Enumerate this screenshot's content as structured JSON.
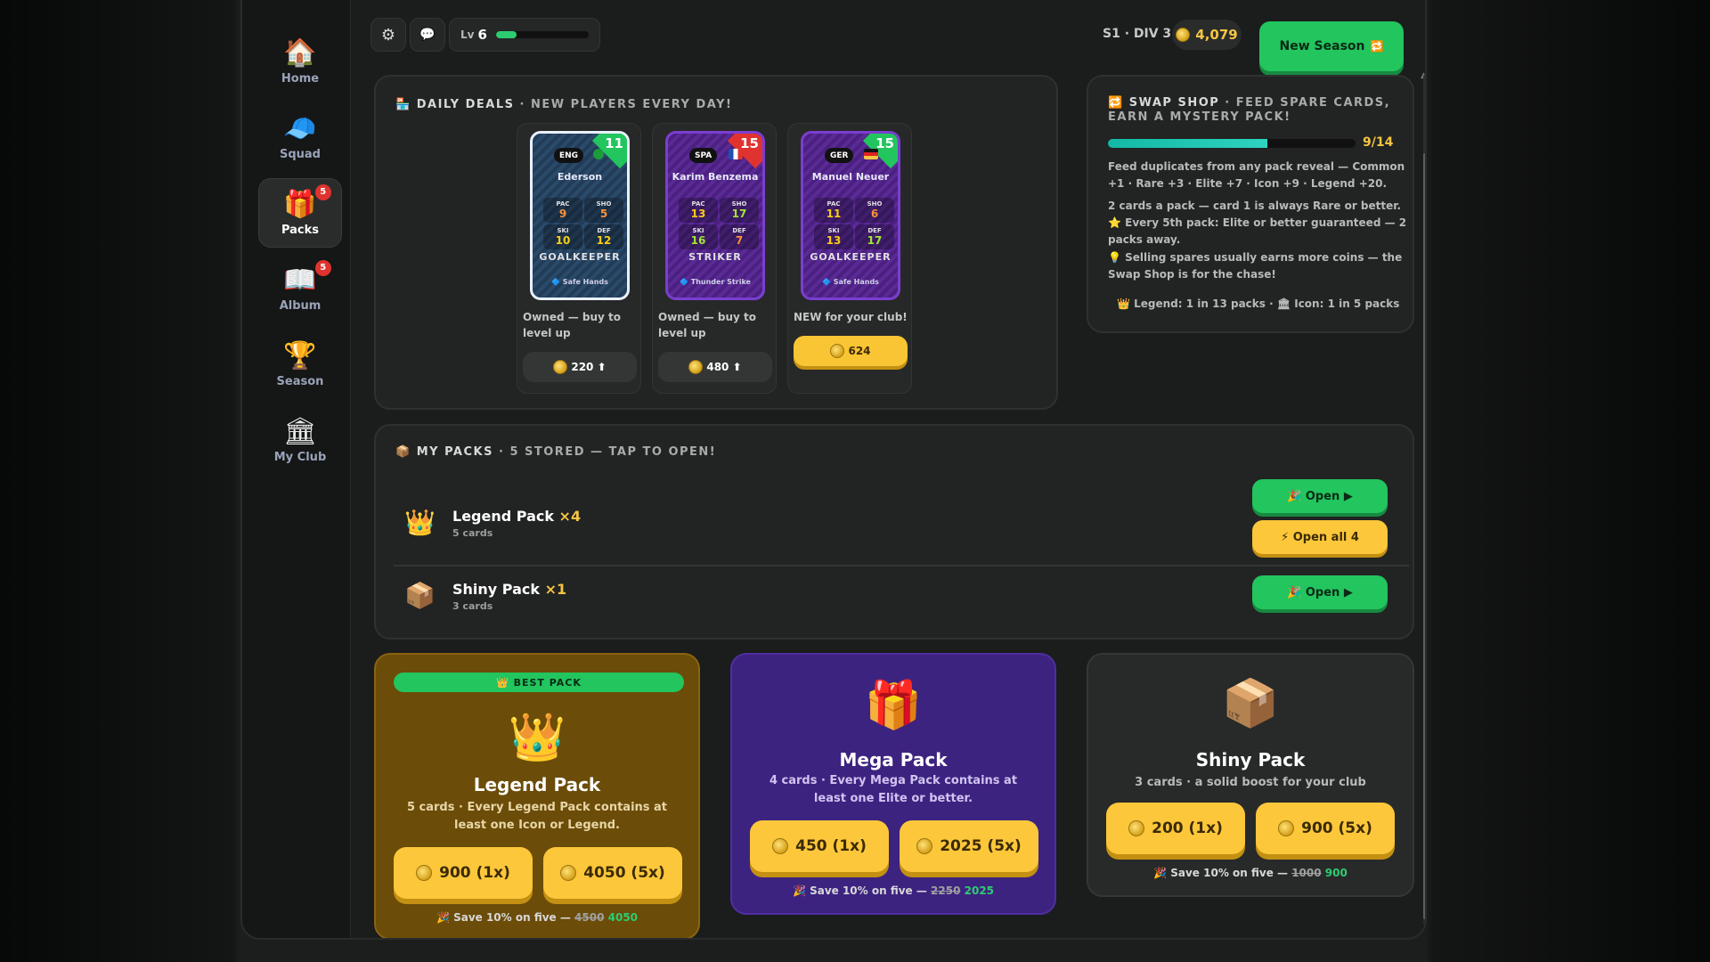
{
  "sidebar": {
    "items": [
      {
        "label": "Home",
        "icon": "🏠"
      },
      {
        "label": "Squad",
        "icon": "🧢"
      },
      {
        "label": "Packs",
        "icon": "🎁",
        "badge": "5"
      },
      {
        "label": "Album",
        "icon": "📖",
        "badge": "5"
      },
      {
        "label": "Season",
        "icon": "🏆"
      },
      {
        "label": "My Club",
        "icon": "🏛"
      }
    ]
  },
  "topbar": {
    "settings_icon": "⚙",
    "chat_icon": "💬",
    "level_prefix": "Lv",
    "level": "6",
    "xp_fraction": 0.22,
    "season": "S1 · DIV 3",
    "coins": "4,079",
    "new_season_label": "New Season",
    "new_season_icon": "🔁"
  },
  "daily_deals": {
    "title_icon": "🏪",
    "title": "DAILY DEALS",
    "subtitle": " · NEW PLAYERS EVERY DAY!",
    "cards": [
      {
        "nation": "ENG",
        "flag": "brazil",
        "rating": "11",
        "name": "Ederson",
        "stats": [
          {
            "l": "PAC",
            "v": "9"
          },
          {
            "l": "SHO",
            "v": "5"
          },
          {
            "l": "SKI",
            "v": "10"
          },
          {
            "l": "DEF",
            "v": "12"
          }
        ],
        "position": "GOALKEEPER",
        "trait": "🔷 Safe Hands",
        "caption": "Owned — buy to level up",
        "price": "220 ⬆",
        "style": "dark",
        "theme": "blue",
        "corner": "green"
      },
      {
        "nation": "SPA",
        "flag": "france",
        "rating": "15",
        "name": "Karim Benzema",
        "stats": [
          {
            "l": "PAC",
            "v": "13"
          },
          {
            "l": "SHO",
            "v": "17"
          },
          {
            "l": "SKI",
            "v": "16"
          },
          {
            "l": "DEF",
            "v": "7"
          }
        ],
        "position": "STRIKER",
        "trait": "🔷 Thunder Strike",
        "caption": "Owned — buy to level up",
        "price": "480 ⬆",
        "style": "dark",
        "theme": "purple",
        "corner": "red"
      },
      {
        "nation": "GER",
        "flag": "germany",
        "rating": "15",
        "name": "Manuel Neuer",
        "stats": [
          {
            "l": "PAC",
            "v": "11"
          },
          {
            "l": "SHO",
            "v": "6"
          },
          {
            "l": "SKI",
            "v": "13"
          },
          {
            "l": "DEF",
            "v": "17"
          }
        ],
        "position": "GOALKEEPER",
        "trait": "🔷 Safe Hands",
        "caption": "NEW for your club!",
        "price": "624",
        "style": "gold",
        "theme": "purple",
        "corner": "green"
      }
    ]
  },
  "swap_shop": {
    "title_icon": "🔁",
    "title": "SWAP SHOP",
    "subtitle": " · FEED SPARE CARDS, EARN A MYSTERY PACK!",
    "progress_fraction": 0.643,
    "progress_label": "9/14",
    "line1": "Feed duplicates from any pack reveal — Common +1 · Rare +3 · Elite +7 · Icon +9 · Legend +20.",
    "line2": "2 cards a pack — card 1 is always Rare or better.",
    "line3": "⭐ Every 5th pack: Elite or better guaranteed — 2 packs away.",
    "line4": "💡 Selling spares usually earns more coins — the Swap Shop is for the chase!",
    "odds": "👑 Legend: 1 in 13 packs · 🏛 Icon: 1 in 5 packs"
  },
  "my_packs": {
    "title_icon": "📦",
    "title": "MY PACKS",
    "subtitle": " · 5 STORED — TAP TO OPEN!",
    "rows": [
      {
        "icon": "👑",
        "name": "Legend Pack",
        "mult": " ×4",
        "sub": "5 cards",
        "open_label": "🎉 Open ▶",
        "open_all_label": "⚡ Open all 4"
      },
      {
        "icon": "📦",
        "name": "Shiny Pack",
        "mult": " ×1",
        "sub": "3 cards",
        "open_label": "🎉 Open ▶"
      }
    ]
  },
  "store": {
    "legend": {
      "banner": "👑 BEST PACK",
      "icon": "👑",
      "name": "Legend Pack",
      "desc": "5 cards · Every Legend Pack contains at least one Icon or Legend.",
      "buy1": "900 (1x)",
      "buy5": "4050 (5x)",
      "save_prefix": "🎉 Save 10% on five — ",
      "old": "4500",
      "new": "4050"
    },
    "mega": {
      "icon": "🎁",
      "name": "Mega Pack",
      "desc": "4 cards · Every Mega Pack contains at least one Elite or better.",
      "buy1": "450 (1x)",
      "buy5": "2025 (5x)",
      "save_prefix": "🎉 Save 10% on five — ",
      "old": "2250",
      "new": "2025"
    },
    "shiny": {
      "icon": "📦",
      "name": "Shiny Pack",
      "desc": "3 cards · a solid boost for your club",
      "buy1": "200 (1x)",
      "buy5": "900 (5x)",
      "save_prefix": "🎉 Save 10% on five — ",
      "old": "1000",
      "new": "900"
    }
  },
  "colors": {
    "accent_green": "#22c55e",
    "gold": "#fcc73a",
    "legend_bg": "#6b4c08",
    "mega_bg": "#3d2380",
    "shiny_bg": "#282a2a"
  }
}
